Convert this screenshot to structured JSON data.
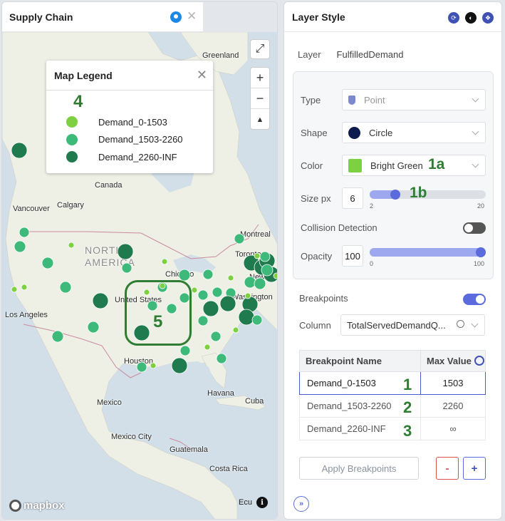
{
  "map_panel": {
    "tab_title": "Supply Chain",
    "pin_icon": "location-pin-icon",
    "close_icon": "close-icon",
    "labels": {
      "greenland": "Greenland",
      "canada": "Canada",
      "vancouver": "Vancouver",
      "calgary": "Calgary",
      "north_america": "NORTH AMERICA",
      "chicago": "Chicago",
      "united_states": "United States",
      "montreal": "Montreal",
      "toronto": "Toronto",
      "new_york": "New York",
      "washington": "Washington",
      "los_angeles": "Los Angeles",
      "houston": "Houston",
      "havana": "Havana",
      "cuba": "Cuba",
      "mexico": "Mexico",
      "mexico_city": "Mexico City",
      "guatemala": "Guatemala",
      "costa_rica": "Costa Rica",
      "ecuador": "Ecu"
    },
    "attribution_logo": "mapbox",
    "callouts": {
      "legend": "4",
      "highlight": "5"
    }
  },
  "legend": {
    "title": "Map Legend",
    "items": [
      {
        "label": "Demand_0-1503",
        "color": "#7ed043"
      },
      {
        "label": "Demand_1503-2260",
        "color": "#3dba7a"
      },
      {
        "label": "Demand_2260-INF",
        "color": "#1f7a4d"
      }
    ]
  },
  "style_panel": {
    "title": "Layer Style",
    "layer_label": "Layer",
    "layer_value": "FulfilledDemand",
    "type_label": "Type",
    "type_value": "Point",
    "shape_label": "Shape",
    "shape_value": "Circle",
    "color_label": "Color",
    "color_value": "Bright Green",
    "color_hex": "#7ed043",
    "size_label": "Size px",
    "size_value": "6",
    "size_min": "2",
    "size_max": "20",
    "collision_label": "Collision Detection",
    "collision_enabled": false,
    "opacity_label": "Opacity",
    "opacity_value": "100",
    "opacity_min": "0",
    "opacity_max": "100",
    "breakpoints_label": "Breakpoints",
    "breakpoints_enabled": true,
    "column_label": "Column",
    "column_value": "TotalServedDemandQ...",
    "table_headers": [
      "Breakpoint Name",
      "Max Value"
    ],
    "rows": [
      {
        "name": "Demand_0-1503",
        "value": "1503"
      },
      {
        "name": "Demand_1503-2260",
        "value": "2260"
      },
      {
        "name": "Demand_2260-INF",
        "value": "∞"
      }
    ],
    "apply_label": "Apply Breakpoints",
    "minus_label": "-",
    "plus_label": "+",
    "callouts": {
      "color": "1a",
      "size": "1b",
      "row1": "1",
      "row2": "2",
      "row3": "3"
    }
  }
}
